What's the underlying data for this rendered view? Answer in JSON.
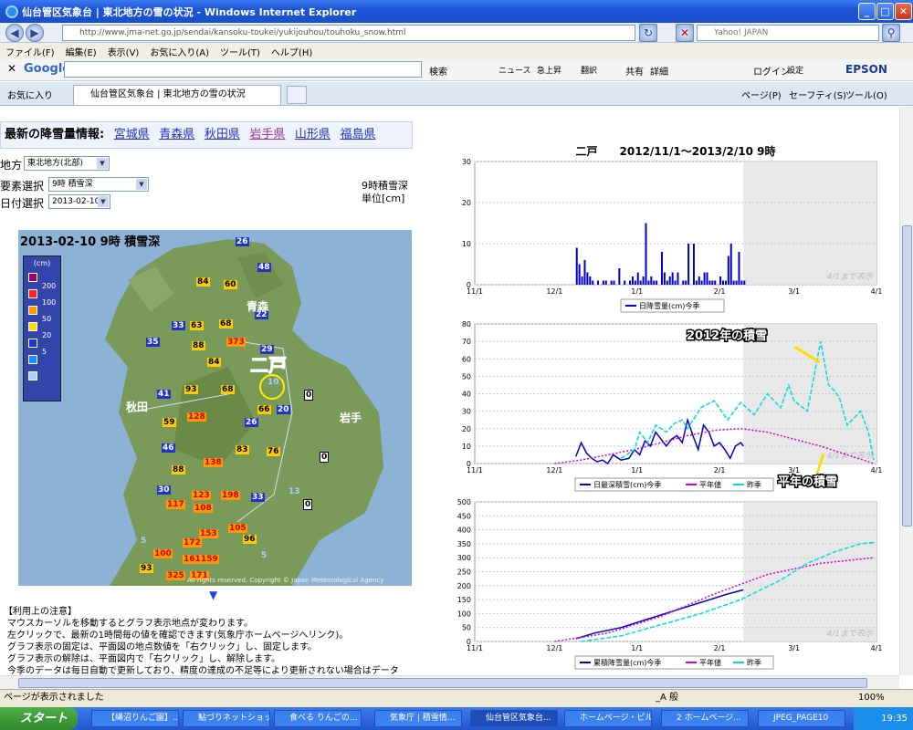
{
  "window": {
    "title": "仙台管区気象台 | 東北地方の雪の状況 - Windows Internet Explorer"
  },
  "browser": {
    "url": "http://www.jma-net.go.jp/sendai/kansoku-toukei/yukijouhou/touhoku_snow.html",
    "search_placeholder": "Yahoo! JAPAN"
  },
  "menu": [
    "ファイル(F)",
    "編集(E)",
    "表示(V)",
    "お気に入り(A)",
    "ツール(T)",
    "ヘルプ(H)"
  ],
  "google": {
    "label": "Google",
    "search": "検索",
    "news": "ニュース",
    "kyujo": "急上昇",
    "translate": "翻訳",
    "share": "共有",
    "detail": "詳細",
    "login": "ログイン",
    "settings": "設定",
    "epson": "EPSON"
  },
  "favorites": {
    "label": "お気に入り",
    "tab": "仙台管区気象台 | 東北地方の雪の状況"
  },
  "commandbar": [
    "ページ(P)",
    "セーフティ(S)",
    "ツール(O)"
  ],
  "page": {
    "latest_label": "最新の降雪量情報:",
    "prefs": [
      "宮城県",
      "青森県",
      "秋田県",
      "岩手県",
      "山形県",
      "福島県"
    ],
    "region_label": "地方",
    "region_value": "東北地方(北部)",
    "element_label": "要素選択",
    "element_value": "9時 積雪深",
    "date_label": "日付選択",
    "date_value": "2013-02-10",
    "unit_line1": "9時積雪深",
    "unit_line2": "単位[cm]",
    "map_title": "2013-02-10 9時 積雪深",
    "legend_unit": "(cm)",
    "legend": [
      "200",
      "100",
      "50",
      "20",
      "5"
    ],
    "legend_colors": [
      "#990066",
      "#ff2222",
      "#ff9900",
      "#ffdd00",
      "#2233cc",
      "#2288ff",
      "#aaccff"
    ],
    "place_labels": [
      "青森",
      "秋田",
      "岩手"
    ],
    "station_label": "二戸",
    "copyright": "All rights reserved. Copyright © Japan Meteorological Agency",
    "notes_title": "【利用上の注意】",
    "notes": [
      "マウスカーソルを移動するとグラフ表示地点が変わります。",
      "左クリックで、最新の1時間毎の値を確認できます(気象庁ホームページへリンク)。",
      "グラフ表示の固定は、平面図の地点数値を「右クリック」し、固定します。",
      "グラフ表示の解除は、平面図内で「右クリック」し、解除します。",
      "今季のデータは毎日自動で更新しており、精度の達成の不足等により更新されない場合はデータ"
    ]
  },
  "map_values": [
    {
      "v": "26",
      "c": "blue"
    },
    {
      "v": "48",
      "c": "blue"
    },
    {
      "v": "84",
      "c": "orange"
    },
    {
      "v": "60",
      "c": "orange"
    },
    {
      "v": "22",
      "c": "blue"
    },
    {
      "v": "33",
      "c": "blue"
    },
    {
      "v": "63",
      "c": "orange"
    },
    {
      "v": "68",
      "c": "orange"
    },
    {
      "v": "35",
      "c": "blue"
    },
    {
      "v": "88",
      "c": "orange"
    },
    {
      "v": "373",
      "c": "red"
    },
    {
      "v": "29",
      "c": "blue"
    },
    {
      "v": "84",
      "c": "orange"
    },
    {
      "v": "10",
      "c": "light"
    },
    {
      "v": "0",
      "c": "white"
    },
    {
      "v": "41",
      "c": "blue"
    },
    {
      "v": "93",
      "c": "orange"
    },
    {
      "v": "68",
      "c": "orange"
    },
    {
      "v": "66",
      "c": "orange"
    },
    {
      "v": "20",
      "c": "blue"
    },
    {
      "v": "59",
      "c": "orange"
    },
    {
      "v": "128",
      "c": "red"
    },
    {
      "v": "26",
      "c": "blue"
    },
    {
      "v": "46",
      "c": "blue"
    },
    {
      "v": "83",
      "c": "orange"
    },
    {
      "v": "76",
      "c": "orange"
    },
    {
      "v": "0",
      "c": "white"
    },
    {
      "v": "138",
      "c": "red"
    },
    {
      "v": "88",
      "c": "orange"
    },
    {
      "v": "30",
      "c": "blue"
    },
    {
      "v": "123",
      "c": "red"
    },
    {
      "v": "198",
      "c": "red"
    },
    {
      "v": "33",
      "c": "blue"
    },
    {
      "v": "13",
      "c": "light"
    },
    {
      "v": "117",
      "c": "red"
    },
    {
      "v": "108",
      "c": "red"
    },
    {
      "v": "0",
      "c": "white"
    },
    {
      "v": "153",
      "c": "red"
    },
    {
      "v": "105",
      "c": "red"
    },
    {
      "v": "5",
      "c": "light"
    },
    {
      "v": "172",
      "c": "red"
    },
    {
      "v": "96",
      "c": "orange"
    },
    {
      "v": "100",
      "c": "red"
    },
    {
      "v": "161",
      "c": "red"
    },
    {
      "v": "159",
      "c": "red"
    },
    {
      "v": "5",
      "c": "light"
    },
    {
      "v": "93",
      "c": "orange"
    },
    {
      "v": "325",
      "c": "red"
    },
    {
      "v": "171",
      "c": "red"
    }
  ],
  "chart_title": "二戸　　2012/11/1～2013/2/10 9時",
  "x_ticks": [
    "11/1",
    "12/1",
    "1/1",
    "2/1",
    "3/1",
    "4/1"
  ],
  "shade_note": "4/1まで表示",
  "chart_data": [
    {
      "type": "bar",
      "ylim": [
        0,
        30
      ],
      "yticks": [
        0,
        10,
        20,
        30
      ],
      "series": [
        {
          "name": "日降雪量(cm)今季",
          "color": "#0000cc",
          "x": [
            38,
            39,
            40,
            41,
            42,
            43,
            44,
            46,
            48,
            49,
            51,
            52,
            54,
            56,
            58,
            59,
            60,
            61,
            62,
            63,
            64,
            65,
            66,
            67,
            68,
            70,
            71,
            72,
            73,
            74,
            75,
            76,
            78,
            79,
            80,
            82,
            83,
            84,
            85,
            86,
            87,
            88,
            89,
            90,
            92,
            93,
            94,
            95,
            96,
            97,
            98,
            99,
            100,
            101
          ],
          "values": [
            9,
            5,
            2,
            6,
            3,
            2,
            1,
            1,
            1,
            1,
            1,
            1,
            4,
            1,
            1,
            2,
            1,
            3,
            1,
            2,
            15,
            1,
            2,
            1,
            1,
            8,
            3,
            1,
            2,
            3,
            1,
            3,
            1,
            1,
            10,
            10,
            1,
            2,
            1,
            3,
            3,
            1,
            1,
            1,
            2,
            1,
            1,
            7,
            10,
            1,
            1,
            8,
            1,
            1
          ]
        }
      ]
    },
    {
      "type": "line",
      "ylim": [
        0,
        80
      ],
      "yticks": [
        0,
        10,
        20,
        30,
        40,
        50,
        60,
        70,
        80
      ],
      "series": [
        {
          "name": "日最深積雪(cm)今季",
          "color": "#0000cc",
          "x": [
            38,
            40,
            42,
            44,
            46,
            48,
            50,
            52,
            55,
            58,
            60,
            62,
            64,
            66,
            68,
            70,
            72,
            74,
            76,
            78,
            80,
            82,
            84,
            86,
            88,
            90,
            92,
            94,
            96,
            98,
            100,
            101
          ],
          "values": [
            4,
            12,
            6,
            3,
            1,
            2,
            0,
            5,
            2,
            3,
            8,
            5,
            13,
            10,
            18,
            14,
            10,
            14,
            16,
            12,
            25,
            16,
            8,
            22,
            18,
            10,
            12,
            8,
            3,
            10,
            12,
            10
          ]
        },
        {
          "name": "平年値",
          "color": "#cc00cc",
          "x": [
            30,
            40,
            50,
            60,
            70,
            80,
            90,
            100,
            110,
            120,
            130,
            140,
            150
          ],
          "values": [
            0,
            2,
            5,
            8,
            12,
            16,
            19,
            20,
            18,
            14,
            10,
            5,
            0
          ]
        },
        {
          "name": "昨季",
          "color": "#00dddd",
          "x": [
            55,
            60,
            62,
            65,
            68,
            70,
            72,
            75,
            78,
            80,
            85,
            90,
            95,
            100,
            105,
            110,
            115,
            118,
            120,
            125,
            130,
            133,
            135,
            137,
            140,
            145,
            148,
            150
          ],
          "values": [
            3,
            8,
            18,
            12,
            22,
            20,
            18,
            23,
            25,
            20,
            32,
            36,
            25,
            35,
            28,
            40,
            32,
            45,
            36,
            30,
            70,
            45,
            42,
            38,
            22,
            30,
            18,
            2
          ]
        }
      ]
    },
    {
      "type": "line",
      "ylim": [
        0,
        500
      ],
      "yticks": [
        0,
        50,
        100,
        150,
        200,
        250,
        300,
        350,
        400,
        450,
        500
      ],
      "series": [
        {
          "name": "累積降雪量(cm)今季",
          "color": "#0000cc",
          "x": [
            38,
            45,
            55,
            65,
            75,
            85,
            95,
            101
          ],
          "values": [
            10,
            30,
            50,
            80,
            110,
            140,
            170,
            185
          ]
        },
        {
          "name": "平年値",
          "color": "#cc00cc",
          "x": [
            30,
            50,
            70,
            90,
            110,
            130,
            150
          ],
          "values": [
            0,
            30,
            90,
            170,
            240,
            280,
            300
          ]
        },
        {
          "name": "昨季",
          "color": "#00dddd",
          "x": [
            40,
            55,
            70,
            85,
            100,
            115,
            125,
            135,
            145,
            150
          ],
          "values": [
            0,
            20,
            60,
            100,
            150,
            220,
            280,
            320,
            350,
            355
          ]
        }
      ]
    }
  ],
  "annotations": {
    "a2012": "2012年の積雪",
    "normal": "平年の積雪"
  },
  "statusbar": "ページが表示されました",
  "taskbar": {
    "start": "スタート",
    "items": [
      "【縄沼りんご園】...",
      "鮎づりネットショッ...",
      "食べる りんごの...",
      "気象庁 | 積雪情...",
      "仙台管区気象台...",
      "ホームページ・ビル...",
      "2 ホームページ...",
      "JPEG_PAGE10"
    ],
    "clock": "19:35",
    "zoom": "100%",
    "ime": "_A 般"
  }
}
